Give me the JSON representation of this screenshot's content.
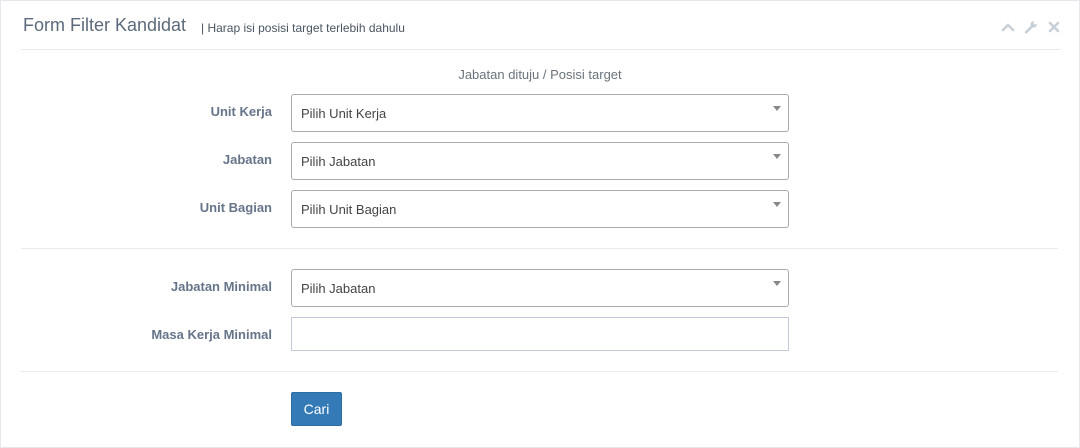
{
  "header": {
    "title": "Form Filter Kandidat",
    "helper": "| Harap isi posisi target terlebih dahulu",
    "tools": [
      "chevron-up-icon",
      "wrench-icon",
      "close-icon"
    ]
  },
  "target_section": {
    "caption": "Jabatan dituju / Posisi target",
    "unit_kerja": {
      "label": "Unit Kerja",
      "value": "Pilih Unit Kerja"
    },
    "jabatan": {
      "label": "Jabatan",
      "value": "Pilih Jabatan"
    },
    "unit_bagian": {
      "label": "Unit Bagian",
      "value": "Pilih Unit Bagian"
    }
  },
  "minimum_section": {
    "jabatan_minimal": {
      "label": "Jabatan Minimal",
      "value": "Pilih Jabatan"
    },
    "masa_kerja_minimal": {
      "label": "Masa Kerja Minimal",
      "value": ""
    }
  },
  "actions": {
    "search_label": "Cari"
  },
  "colors": {
    "primary_button": "#337ab7",
    "label": "#66748a",
    "title": "#5c6b7b"
  }
}
